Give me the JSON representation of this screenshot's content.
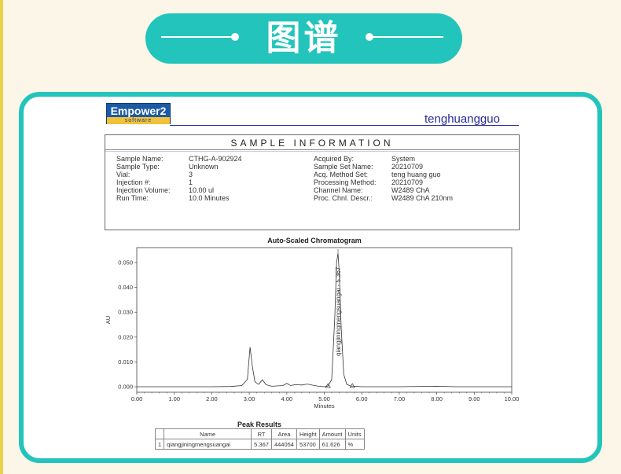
{
  "header": {
    "title": "图谱"
  },
  "logo": {
    "name": "Empower2",
    "sub": "software"
  },
  "username": "tenghuangguo",
  "sample_info": {
    "title": "SAMPLE   INFORMATION",
    "left": [
      {
        "label": "Sample Name:",
        "value": "CTHG-A-902924"
      },
      {
        "label": "Sample Type:",
        "value": "Unknown"
      },
      {
        "label": "Vial:",
        "value": "3"
      },
      {
        "label": "Injection #:",
        "value": "1"
      },
      {
        "label": "Injection Volume:",
        "value": "10.00 ul"
      },
      {
        "label": "Run Time:",
        "value": "10.0 Minutes"
      }
    ],
    "right": [
      {
        "label": "Acquired By:",
        "value": "System"
      },
      {
        "label": "Sample Set Name:",
        "value": "20210709"
      },
      {
        "label": "Acq. Method Set:",
        "value": "teng huang guo"
      },
      {
        "label": "Processing Method:",
        "value": "20210709"
      },
      {
        "label": "Channel Name:",
        "value": "W2489 ChA"
      },
      {
        "label": "Proc. Chnl. Descr.:",
        "value": "W2489 ChA 210nm"
      }
    ]
  },
  "chart_data": {
    "type": "line",
    "title": "Auto-Scaled Chromatogram",
    "xlabel": "Minutes",
    "ylabel": "AU",
    "xlim": [
      0,
      10
    ],
    "ylim": [
      -0.0022,
      0.056
    ],
    "x_ticks": [
      "0.00",
      "1.00",
      "2.00",
      "3.00",
      "4.00",
      "5.00",
      "6.00",
      "7.00",
      "8.00",
      "9.00",
      "10.00"
    ],
    "y_ticks": [
      "0.000",
      "0.010",
      "0.020",
      "0.030",
      "0.040",
      "0.050"
    ],
    "peak_label": "qiangjiningmengsuangai - 5.367",
    "series": [
      {
        "x": [
          0.0,
          1.0,
          2.0,
          2.5,
          2.8,
          2.95,
          3.02,
          3.08,
          3.15,
          3.25,
          3.35,
          3.45,
          3.6,
          3.9,
          4.0,
          4.1,
          4.25,
          4.4,
          4.55,
          4.7,
          4.85,
          5.0,
          5.1,
          5.2,
          5.28,
          5.33,
          5.367,
          5.4,
          5.45,
          5.52,
          5.6,
          5.7,
          5.8,
          6.0,
          7.0,
          8.0,
          8.5,
          9.0,
          10.0
        ],
        "y": [
          0.0,
          0.0,
          0.0,
          0.0001,
          0.0005,
          0.003,
          0.016,
          0.0085,
          0.002,
          0.001,
          0.0028,
          0.0008,
          0.0002,
          0.0005,
          0.0014,
          0.0005,
          0.0009,
          0.0007,
          0.0011,
          0.0006,
          0.0002,
          0.0,
          0.0003,
          0.003,
          0.028,
          0.05,
          0.0537,
          0.046,
          0.024,
          0.005,
          0.001,
          0.0003,
          0.0002,
          0.0,
          0.0,
          0.0002,
          0.0,
          0.0,
          0.0
        ]
      }
    ],
    "peak_rt": 5.367
  },
  "peak_results": {
    "title": "Peak Results",
    "headers": [
      "",
      "Name",
      "RT",
      "Area",
      "Height",
      "Amount",
      "Units"
    ],
    "rows": [
      [
        "1",
        "qiangjiningmengsuangai",
        "5.367",
        "444054",
        "53700",
        "61.626",
        "%"
      ]
    ]
  }
}
